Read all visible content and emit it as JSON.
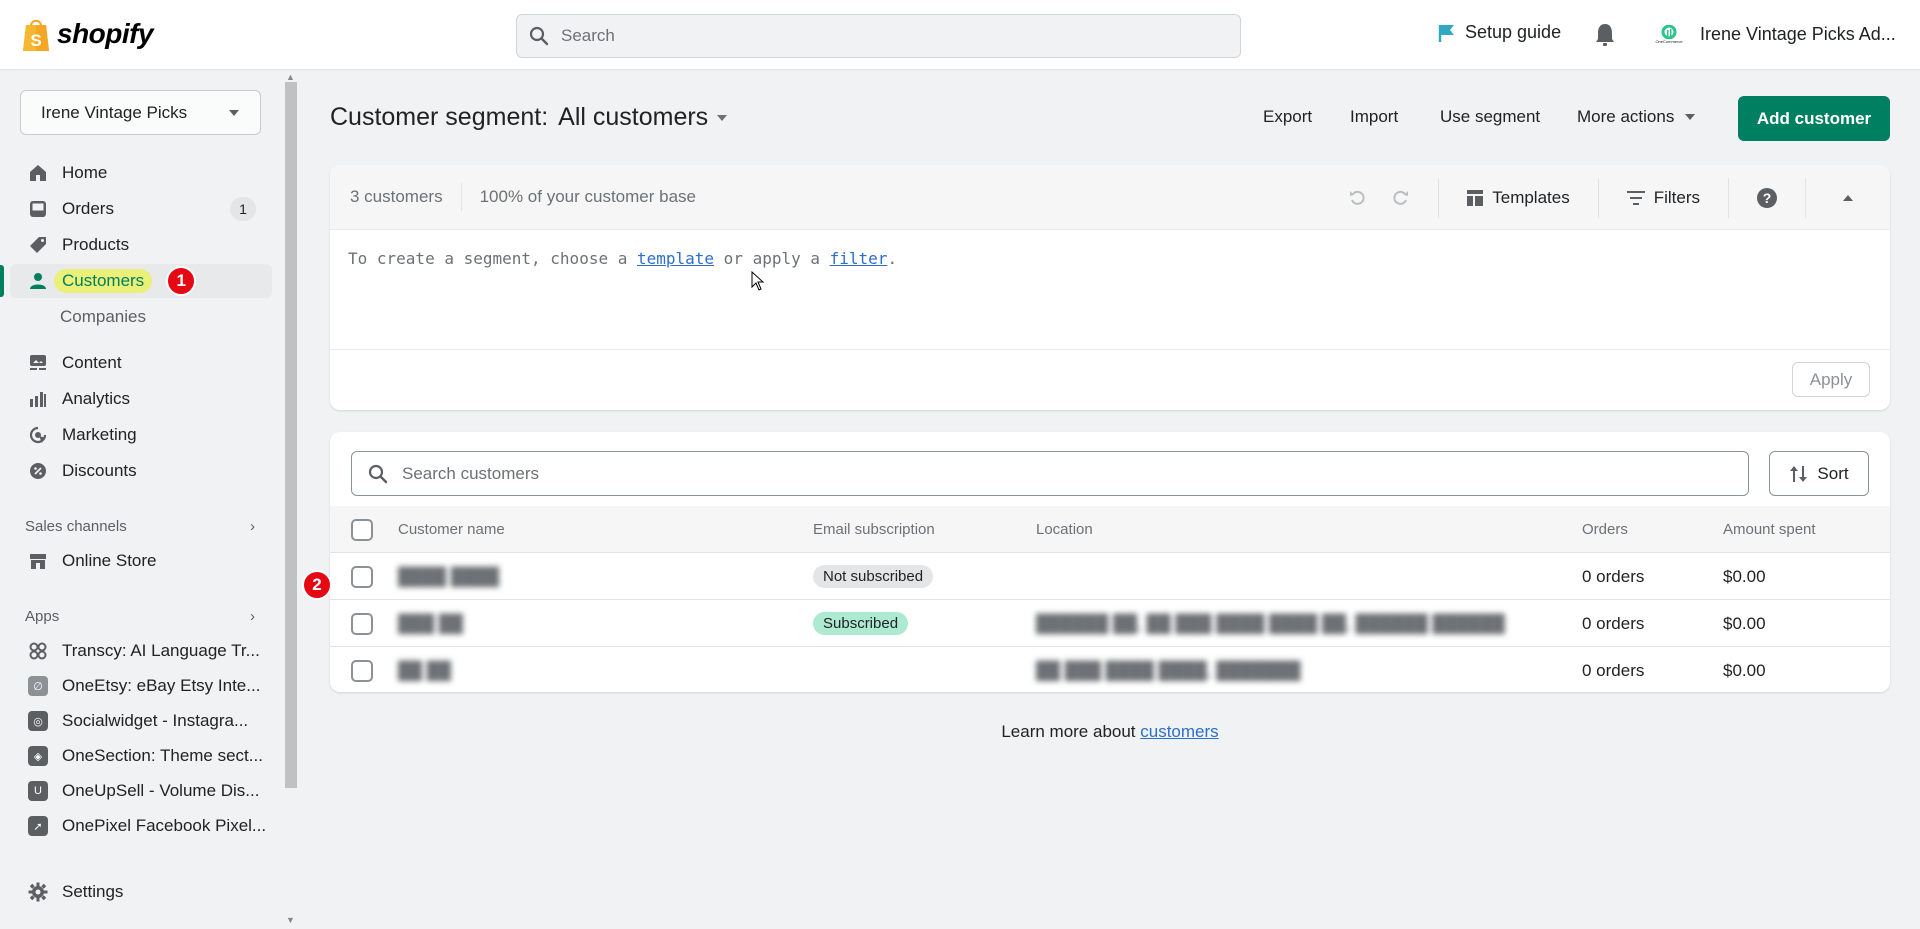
{
  "topbar": {
    "logo_text": "shopify",
    "search_placeholder": "Search",
    "setup_guide": "Setup guide",
    "store_logo_caption": "OneCommerce",
    "store_name": "Irene Vintage Picks Ad..."
  },
  "sidebar": {
    "store_selector": "Irene Vintage Picks",
    "nav": [
      {
        "label": "Home",
        "icon": "home-icon"
      },
      {
        "label": "Orders",
        "icon": "orders-icon",
        "badge": "1"
      },
      {
        "label": "Products",
        "icon": "tag-icon"
      },
      {
        "label": "Customers",
        "icon": "person-icon",
        "active": true,
        "step_badge": "1"
      },
      {
        "label": "Companies",
        "sub": true
      },
      {
        "label": "Content",
        "icon": "content-icon"
      },
      {
        "label": "Analytics",
        "icon": "bar-chart-icon"
      },
      {
        "label": "Marketing",
        "icon": "target-icon"
      },
      {
        "label": "Discounts",
        "icon": "discount-icon"
      }
    ],
    "sales_channels_label": "Sales channels",
    "sales_channels": [
      {
        "label": "Online Store",
        "icon": "store-icon"
      }
    ],
    "apps_label": "Apps",
    "apps": [
      {
        "label": "Transcy: AI Language Tr..."
      },
      {
        "label": "OneEtsy: eBay Etsy Inte..."
      },
      {
        "label": "Socialwidget - Instagra..."
      },
      {
        "label": "OneSection: Theme sect..."
      },
      {
        "label": "OneUpSell - Volume Dis..."
      },
      {
        "label": "OnePixel Facebook Pixel..."
      }
    ],
    "settings": "Settings"
  },
  "page": {
    "title_prefix": "Customer segment:",
    "segment_name": "All customers",
    "actions": {
      "export": "Export",
      "import": "Import",
      "use_segment": "Use segment",
      "more_actions": "More actions",
      "add_customer": "Add customer"
    }
  },
  "segment_card": {
    "count": "3 customers",
    "percent": "100% of your customer base",
    "templates": "Templates",
    "filters": "Filters",
    "editor_text_1": "To create a segment, choose a ",
    "editor_link_template": "template",
    "editor_text_2": " or apply a ",
    "editor_link_filter": "filter",
    "editor_text_3": ".",
    "apply": "Apply"
  },
  "table": {
    "search_placeholder": "Search customers",
    "sort": "Sort",
    "columns": [
      "Customer name",
      "Email subscription",
      "Location",
      "Orders",
      "Amount spent"
    ],
    "row_step_badge": "2",
    "rows": [
      {
        "name": "[blurred]",
        "subscription": "Not subscribed",
        "location": "",
        "orders": "0 orders",
        "amount": "$0.00"
      },
      {
        "name": "[blurred]",
        "subscription": "Subscribed",
        "location": "[blurred]",
        "orders": "0 orders",
        "amount": "$0.00"
      },
      {
        "name": "[blurred]",
        "subscription": "",
        "location": "[blurred]",
        "orders": "0 orders",
        "amount": "$0.00"
      }
    ]
  },
  "footer": {
    "learn_text": "Learn more about ",
    "learn_link": "customers"
  },
  "colors": {
    "primary": "#008060",
    "link": "#2c6ecb",
    "subscribed": "#aee9d1",
    "highlight": "#eaf078",
    "step_badge": "#e50914"
  }
}
